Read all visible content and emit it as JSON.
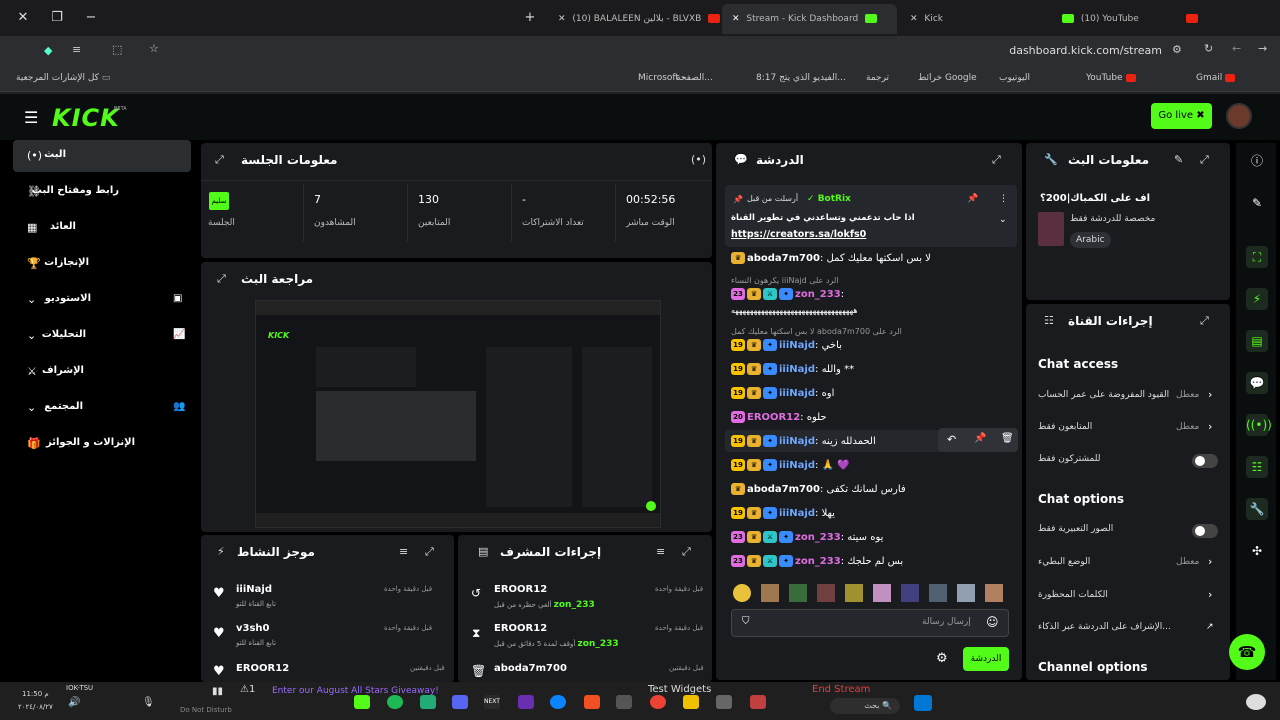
{
  "browser": {
    "tabs": [
      {
        "label": "(10) BALALEEN بلالين - BLVXB"
      },
      {
        "label": "Stream - Kick Dashboard"
      },
      {
        "label": "Kick"
      },
      {
        "label": "(10) YouTube"
      }
    ],
    "url": "dashboard.kick.com/stream",
    "bookmarks": {
      "all": "كل الإشارات المرجعية",
      "items": [
        "Gmail",
        "YouTube",
        "اليوتيوب",
        "خرائط Google",
        "ترجمة",
        "8:17 الفيديو الذي يتج...",
        "الصفحة...",
        "Microsoft –"
      ]
    }
  },
  "header": {
    "logo": "KICK",
    "beta": "BETA",
    "golive": "Go live"
  },
  "sidebar": {
    "items": [
      {
        "label": "البث"
      },
      {
        "label": "رابط ومفتاح البث"
      },
      {
        "label": "العائد"
      },
      {
        "label": "الإنجازات"
      },
      {
        "label": "الاستوديو"
      },
      {
        "label": "التحليلات"
      },
      {
        "label": "الإشراف"
      },
      {
        "label": "المجتمع"
      },
      {
        "label": "الإنزالات و الجوائز"
      }
    ]
  },
  "session": {
    "title": "معلومات الجلسة",
    "stats": [
      {
        "value": "00:52:56",
        "label": "الوقت مباشر"
      },
      {
        "value": "-",
        "label": "تعداد الاشتراكات"
      },
      {
        "value": "130",
        "label": "المتابعين"
      },
      {
        "value": "7",
        "label": "المشاهدون"
      },
      {
        "value": "سليم",
        "label": "الجلسة"
      }
    ]
  },
  "preview": {
    "title": "مراجعة البث"
  },
  "activity": {
    "title": "موجز النشاط",
    "items": [
      {
        "name": "iiiNajd",
        "sub": "تابع القناة للتو",
        "time": "قبل دقيقة واحدة"
      },
      {
        "name": "v3sh0",
        "sub": "تابع القناة للتو",
        "time": "قبل دقيقة واحدة"
      },
      {
        "name": "EROOR12",
        "sub": "",
        "time": "قبل دقيقتين"
      }
    ]
  },
  "modactions": {
    "title": "إجراءات المشرف",
    "items": [
      {
        "name": "EROOR12",
        "sub": "ألغي حظره من قبل",
        "target": "zon_233",
        "time": "قبل دقيقة واحدة"
      },
      {
        "name": "EROOR12",
        "sub": "أوقف لمدة 5 دقائق من قبل",
        "target": "zon_233",
        "time": "قبل دقيقة واحدة"
      },
      {
        "name": "aboda7m700",
        "sub": "",
        "target": "",
        "time": "قبل دقيقتين"
      }
    ]
  },
  "chat": {
    "title": "الدردشة",
    "pinned": {
      "by": "أرسلت من قبل",
      "user": "BotRix",
      "text": "اذا حاب تدعمني وتساعدني في تطوير القناة",
      "link": "https://creators.sa/lokfs0"
    },
    "messages": [
      {
        "user": "aboda7m700",
        "text": "لا بس اسكتها معليك كمل",
        "color": "#fff",
        "badge": ""
      },
      {
        "reply": "يكرهون النساء iiiNajd الرد على"
      },
      {
        "user": "zon_233",
        "text": "",
        "color": "#e06de0",
        "badge": "23"
      },
      {
        "text": "هههههههههههههههههههههههههههههههههه"
      },
      {
        "reply": "لا بس اسكتها معليك كمل aboda7m700 الرد على"
      },
      {
        "user": "iiiNajd",
        "text": "باخي",
        "color": "#6ea8ff",
        "badge": "19"
      },
      {
        "user": "iiiNajd",
        "text": "والله **",
        "color": "#6ea8ff",
        "badge": "19"
      },
      {
        "user": "iiiNajd",
        "text": "اوه",
        "color": "#6ea8ff",
        "badge": "19"
      },
      {
        "user": "EROOR12",
        "text": "حلوه",
        "color": "#e06de0",
        "badge": "20"
      },
      {
        "user": "iiiNajd",
        "text": "الحمدلله زينه",
        "color": "#6ea8ff",
        "badge": "19"
      },
      {
        "user": "iiiNajd",
        "text": "🙏 💜",
        "color": "#6ea8ff",
        "badge": "19"
      },
      {
        "user": "aboda7m700",
        "text": "فارس لسانك تكفى",
        "color": "#fff",
        "badge": ""
      },
      {
        "user": "iiiNajd",
        "text": "يهلا",
        "color": "#6ea8ff",
        "badge": "19"
      },
      {
        "user": "zon_233",
        "text": "يوه سيته",
        "color": "#e06de0",
        "badge": "23"
      },
      {
        "user": "zon_233",
        "text": "بس لم حلجك",
        "color": "#e06de0",
        "badge": "23"
      }
    ],
    "input_placeholder": "إرسال رسالة",
    "send": "الدردشة"
  },
  "streaminfo": {
    "title": "معلومات البث",
    "stream_title": "اف على الكمباك|200؟",
    "desc": "مخصصة للدردشة فقط",
    "lang": "Arabic"
  },
  "channelactions": {
    "title": "إجراءات القناة",
    "chat_access": "Chat access",
    "access_rows": [
      {
        "label": "القيود المفروضة على عمر الحساب",
        "state": "معطل"
      },
      {
        "label": "المتابعون فقط",
        "state": "معطل"
      },
      {
        "label": "للمشتركون فقط",
        "state": ""
      }
    ],
    "chat_options": "Chat options",
    "option_rows": [
      {
        "label": "الصور التعبيرية فقط",
        "state": ""
      },
      {
        "label": "الوضع البطيء",
        "state": "معطل"
      },
      {
        "label": "الكلمات المحظورة",
        "state": ""
      },
      {
        "label": "الإشراف على الدردشة عبر الذكاء...",
        "state": ""
      }
    ],
    "channel_options": "Channel options"
  },
  "taskbar": {
    "time": "11:50 م",
    "date": "٢٠٢٤/٠٨/٢٧",
    "user": "IOK-TSU",
    "dnd": "Do Not Disturb",
    "giveaway": "Enter our August All Stars Giveaway!",
    "test_widgets": "Test Widgets",
    "end_stream": "End Stream",
    "search": "بحث"
  },
  "colors": {
    "accent": "#53fc18",
    "panel": "#191b1f"
  }
}
